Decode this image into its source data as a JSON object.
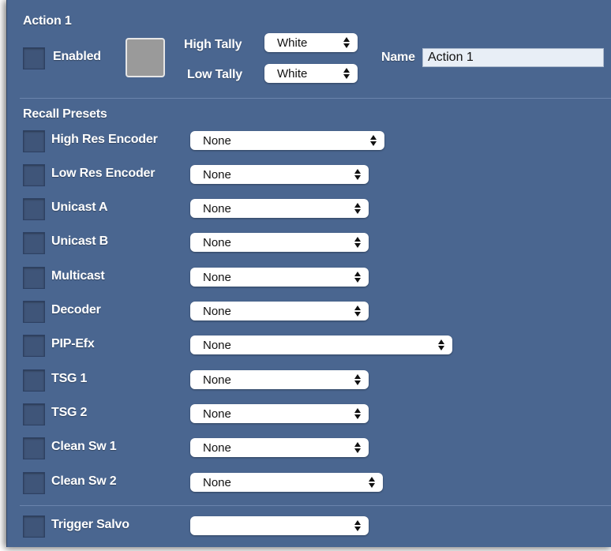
{
  "header": {
    "title": "Action 1",
    "enabled_label": "Enabled",
    "high_tally_label": "High Tally",
    "high_tally_value": "White",
    "low_tally_label": "Low Tally",
    "low_tally_value": "White",
    "name_label": "Name",
    "name_value": "Action 1",
    "swatch_color": "#9a9a9a"
  },
  "recall": {
    "title": "Recall Presets",
    "rows": [
      {
        "label": "High Res Encoder",
        "value": "None"
      },
      {
        "label": "Low Res Encoder",
        "value": "None"
      },
      {
        "label": "Unicast A",
        "value": "None"
      },
      {
        "label": "Unicast B",
        "value": "None"
      },
      {
        "label": "Multicast",
        "value": "None"
      },
      {
        "label": "Decoder",
        "value": "None"
      },
      {
        "label": "PIP-Efx",
        "value": "None"
      },
      {
        "label": "TSG 1",
        "value": "None"
      },
      {
        "label": "TSG 2",
        "value": "None"
      },
      {
        "label": "Clean Sw 1",
        "value": "None"
      },
      {
        "label": "Clean Sw 2",
        "value": "None"
      }
    ]
  },
  "trigger": {
    "label": "Trigger Salvo",
    "value": ""
  },
  "colors": {
    "panel": "#4a6690",
    "checkbox": "#3f5579"
  }
}
